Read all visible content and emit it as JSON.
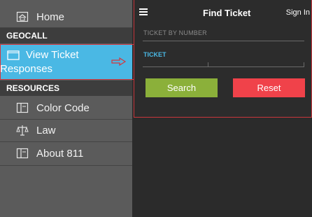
{
  "sidebar": {
    "home_label": "Home",
    "section_geocall": "GEOCALL",
    "active_item": {
      "line1": "View Ticket",
      "line2": "Responses"
    },
    "section_resources": "RESOURCES",
    "items": [
      {
        "label": "Color Code",
        "icon": "book-icon"
      },
      {
        "label": "Law",
        "icon": "scales-icon"
      },
      {
        "label": "About 811",
        "icon": "book-icon"
      }
    ]
  },
  "header": {
    "title": "Find Ticket",
    "sign_in": "Sign In"
  },
  "form": {
    "by_number_label": "TICKET BY NUMBER",
    "ticket_label": "TICKET",
    "ticket_value": "",
    "search_label": "Search",
    "reset_label": "Reset"
  },
  "colors": {
    "sidebar_bg": "#5b5b5b",
    "section_bg": "#3d3d3d",
    "active_bg": "#4ab8e4",
    "search_btn": "#8bb03a",
    "reset_btn": "#f0424a",
    "highlight_border": "#d5363c"
  }
}
